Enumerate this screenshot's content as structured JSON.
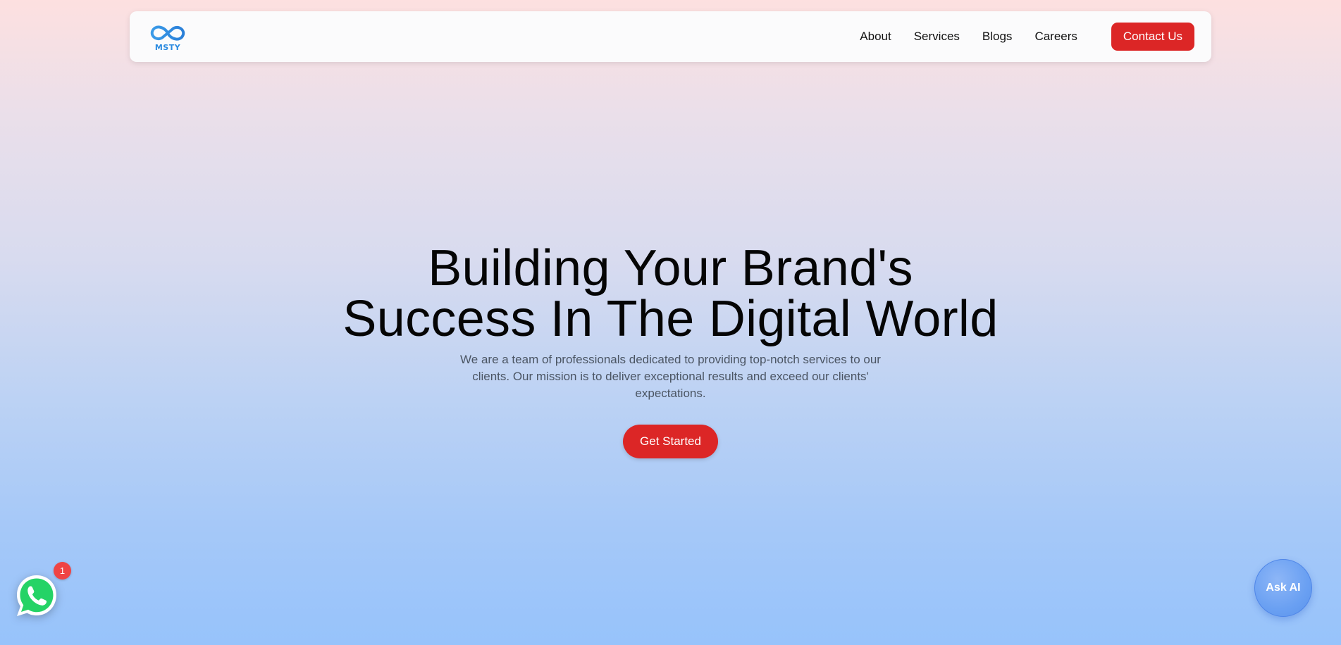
{
  "header": {
    "logo": {
      "icon": "infinity-logo-icon",
      "text": "MSTY",
      "color": "#2a8ae0"
    },
    "nav_items": [
      {
        "label": "About"
      },
      {
        "label": "Services"
      },
      {
        "label": "Blogs"
      },
      {
        "label": "Careers"
      }
    ],
    "contact_label": "Contact Us"
  },
  "hero": {
    "title_line1": "Building Your Brand's",
    "title_line2": "Success In The Digital World",
    "subtitle": "We are a team of professionals dedicated to providing top-notch services to our clients. Our mission is to deliver exceptional results and exceed our clients' expectations.",
    "cta_label": "Get Started"
  },
  "floating": {
    "whatsapp": {
      "icon": "whatsapp-icon",
      "badge_count": "1"
    },
    "ask_ai_label": "Ask AI"
  },
  "colors": {
    "accent": "#dc2626",
    "background_top": "#fde0e0",
    "background_bottom": "#97c3fb",
    "whatsapp_green": "#25d366",
    "ask_ai_blue": "#6aa0f2"
  }
}
